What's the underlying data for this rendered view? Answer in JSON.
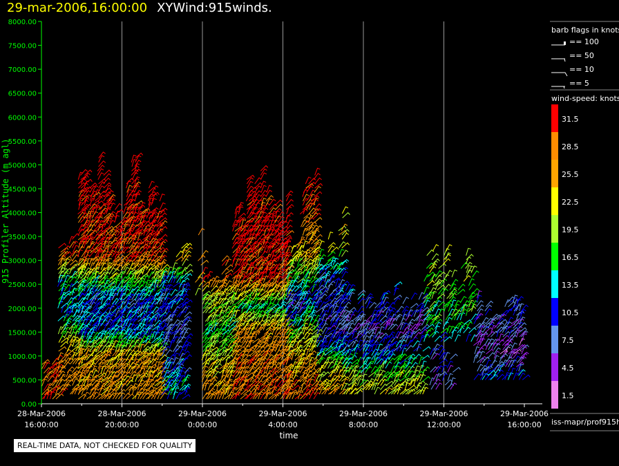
{
  "header": {
    "datetime": "29-mar-2006,16:00:00",
    "product": "XYWind:915winds."
  },
  "quality_notice": "REAL-TIME DATA, NOT CHECKED FOR QUALITY",
  "source_label": "iss-mapr/prof915h",
  "chart_data": {
    "type": "wind-barb time-height",
    "xlabel": "time",
    "ylabel": "915 Profiler Altitude (m agl)",
    "ylim": [
      0,
      8000
    ],
    "yticks": [
      "0.00",
      "500.00",
      "1000.00",
      "1500.00",
      "2000.00",
      "2500.00",
      "3000.00",
      "3500.00",
      "4000.00",
      "4500.00",
      "5000.00",
      "5500.00",
      "6000.00",
      "6500.00",
      "7000.00",
      "7500.00",
      "8000.00"
    ],
    "xlim": [
      "28-Mar-2006 16:00",
      "29-Mar-2006 16:00"
    ],
    "xticks": [
      {
        "date": "28-Mar-2006",
        "time": "16:00:00"
      },
      {
        "date": "28-Mar-2006",
        "time": "20:00:00"
      },
      {
        "date": "29-Mar-2006",
        "time": "0:00:00"
      },
      {
        "date": "29-Mar-2006",
        "time": "4:00:00"
      },
      {
        "date": "29-Mar-2006",
        "time": "8:00:00"
      },
      {
        "date": "29-Mar-2006",
        "time": "12:00:00"
      },
      {
        "date": "29-Mar-2006",
        "time": "16:00:00"
      }
    ],
    "grid": "vertical at major x ticks",
    "barb_legend": {
      "title": "barb flags in knots",
      "items": [
        "== 100",
        "== 50",
        "== 10",
        "== 5"
      ]
    },
    "colorbar": {
      "title": "wind-speed: knots",
      "labels": [
        "31.5",
        "28.5",
        "25.5",
        "22.5",
        "19.5",
        "16.5",
        "13.5",
        "10.5",
        "7.5",
        "4.5",
        "1.5"
      ],
      "colors": [
        "#ff0000",
        "#ff8c00",
        "#ffa500",
        "#ffff00",
        "#adff2f",
        "#00ff00",
        "#00ffff",
        "#0000ff",
        "#6495ed",
        "#a020f0",
        "#ee82ee"
      ]
    },
    "profiles": [
      {
        "start": "28-Mar-2006 16:00",
        "end": "28-Mar-2006 16:50",
        "bottom": 100,
        "top": 800,
        "density": 0.8,
        "speed": [
          [
            0,
            30
          ],
          [
            800,
            29
          ]
        ]
      },
      {
        "start": "28-Mar-2006 16:50",
        "end": "28-Mar-2006 17:50",
        "bottom": 200,
        "top": 3400,
        "density": 0.7,
        "speed": [
          [
            0,
            28
          ],
          [
            1000,
            26
          ],
          [
            1800,
            12
          ],
          [
            2500,
            14
          ],
          [
            2800,
            22
          ],
          [
            3200,
            32
          ]
        ]
      },
      {
        "start": "28-Mar-2006 17:50",
        "end": "28-Mar-2006 22:00",
        "bottom": 100,
        "top": 4400,
        "density": 0.9,
        "speed": [
          [
            0,
            27
          ],
          [
            1000,
            25
          ],
          [
            1400,
            12
          ],
          [
            2200,
            11
          ],
          [
            2700,
            21
          ],
          [
            3000,
            30
          ],
          [
            4800,
            33
          ]
        ]
      },
      {
        "start": "28-Mar-2006 22:00",
        "end": "28-Mar-2006 23:10",
        "bottom": 100,
        "top": 3000,
        "density": 0.7,
        "speed": [
          [
            0,
            14
          ],
          [
            1500,
            8
          ],
          [
            2500,
            12
          ],
          [
            3000,
            24
          ]
        ]
      },
      {
        "start": "28-Mar-2006 23:40",
        "end": "29-Mar-2006 0:00",
        "bottom": 2000,
        "top": 3600,
        "density": 0.25,
        "speed": [
          [
            2000,
            18
          ],
          [
            3600,
            31
          ]
        ]
      },
      {
        "start": "29-Mar-2006 0:00",
        "end": "29-Mar-2006 1:30",
        "bottom": 100,
        "top": 2600,
        "density": 0.85,
        "speed": [
          [
            0,
            28
          ],
          [
            800,
            22
          ],
          [
            1500,
            16
          ],
          [
            2300,
            22
          ],
          [
            2600,
            30
          ]
        ]
      },
      {
        "start": "29-Mar-2006 1:30",
        "end": "29-Mar-2006 4:10",
        "bottom": 100,
        "top": 4400,
        "density": 0.9,
        "speed": [
          [
            0,
            30
          ],
          [
            1500,
            26
          ],
          [
            2000,
            15
          ],
          [
            2600,
            31
          ],
          [
            4500,
            33
          ]
        ]
      },
      {
        "start": "29-Mar-2006 4:10",
        "end": "29-Mar-2006 5:00",
        "bottom": 100,
        "top": 3600,
        "density": 0.8,
        "speed": [
          [
            0,
            30
          ],
          [
            1200,
            22
          ],
          [
            2000,
            8
          ],
          [
            3000,
            22
          ],
          [
            3600,
            30
          ]
        ]
      },
      {
        "start": "29-Mar-2006 5:00",
        "end": "29-Mar-2006 5:40",
        "bottom": 100,
        "top": 4400,
        "density": 0.8,
        "speed": [
          [
            0,
            31
          ],
          [
            1500,
            20
          ],
          [
            2200,
            10
          ],
          [
            3000,
            24
          ],
          [
            4400,
            32
          ]
        ]
      },
      {
        "start": "29-Mar-2006 5:40",
        "end": "29-Mar-2006 7:00",
        "bottom": 200,
        "top": 3400,
        "density": 0.7,
        "speed": [
          [
            0,
            28
          ],
          [
            700,
            20
          ],
          [
            1500,
            8
          ],
          [
            2500,
            10
          ],
          [
            3400,
            22
          ]
        ]
      },
      {
        "start": "29-Mar-2006 7:00",
        "end": "29-Mar-2006 11:00",
        "bottom": 200,
        "top": 2100,
        "density": 0.6,
        "speed": [
          [
            0,
            24
          ],
          [
            600,
            18
          ],
          [
            1000,
            12
          ],
          [
            1500,
            6
          ],
          [
            2100,
            10
          ]
        ]
      },
      {
        "start": "29-Mar-2006 11:00",
        "end": "29-Mar-2006 13:30",
        "bottom": 1300,
        "top": 2900,
        "density": 0.4,
        "speed": [
          [
            1300,
            14
          ],
          [
            2000,
            17
          ],
          [
            2900,
            20
          ]
        ]
      },
      {
        "start": "29-Mar-2006 11:20",
        "end": "29-Mar-2006 12:30",
        "bottom": 300,
        "top": 1000,
        "density": 0.4,
        "speed": [
          [
            300,
            6
          ],
          [
            1000,
            9
          ]
        ]
      },
      {
        "start": "29-Mar-2006 13:30",
        "end": "29-Mar-2006 16:00",
        "bottom": 500,
        "top": 1900,
        "density": 0.6,
        "speed": [
          [
            500,
            12
          ],
          [
            1000,
            5
          ],
          [
            1900,
            8
          ]
        ]
      }
    ]
  }
}
